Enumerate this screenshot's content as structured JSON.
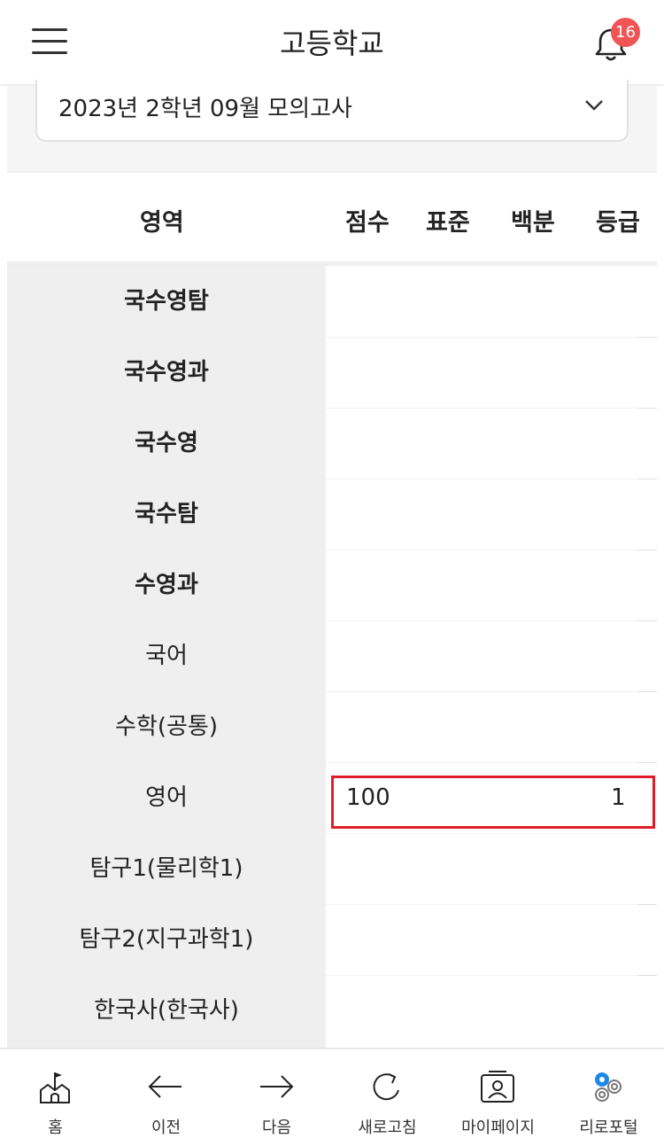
{
  "header": {
    "title": "고등학교",
    "notification_count": "16"
  },
  "exam_select": {
    "value": "2023년 2학년 09월 모의고사"
  },
  "table": {
    "headers": {
      "area": "영역",
      "score": "점수",
      "standard": "표준",
      "percentile": "백분",
      "grade": "등급"
    },
    "rows": [
      {
        "area": "국수영탐",
        "bold": true,
        "score": "",
        "grade": ""
      },
      {
        "area": "국수영과",
        "bold": true,
        "score": "",
        "grade": ""
      },
      {
        "area": "국수영",
        "bold": true,
        "score": "",
        "grade": ""
      },
      {
        "area": "국수탐",
        "bold": true,
        "score": "",
        "grade": ""
      },
      {
        "area": "수영과",
        "bold": true,
        "score": "",
        "grade": ""
      },
      {
        "area": "국어",
        "bold": false,
        "score": "",
        "grade": ""
      },
      {
        "area": "수학(공통)",
        "bold": false,
        "score": "",
        "grade": ""
      },
      {
        "area": "영어",
        "bold": false,
        "score": "100",
        "grade": "1"
      },
      {
        "area": "탐구1(물리학1)",
        "bold": false,
        "score": "",
        "grade": ""
      },
      {
        "area": "탐구2(지구과학1)",
        "bold": false,
        "score": "",
        "grade": ""
      },
      {
        "area": "한국사(한국사)",
        "bold": false,
        "score": "",
        "grade": ""
      }
    ]
  },
  "highlight_color": "#e01e2a",
  "badge_color": "#f05454",
  "bottom_nav": [
    {
      "label": "홈",
      "icon": "school-home-icon"
    },
    {
      "label": "이전",
      "icon": "arrow-left-icon"
    },
    {
      "label": "다음",
      "icon": "arrow-right-icon"
    },
    {
      "label": "새로고침",
      "icon": "refresh-icon"
    },
    {
      "label": "마이페이지",
      "icon": "profile-card-icon"
    },
    {
      "label": "리로포털",
      "icon": "portal-icon"
    }
  ]
}
